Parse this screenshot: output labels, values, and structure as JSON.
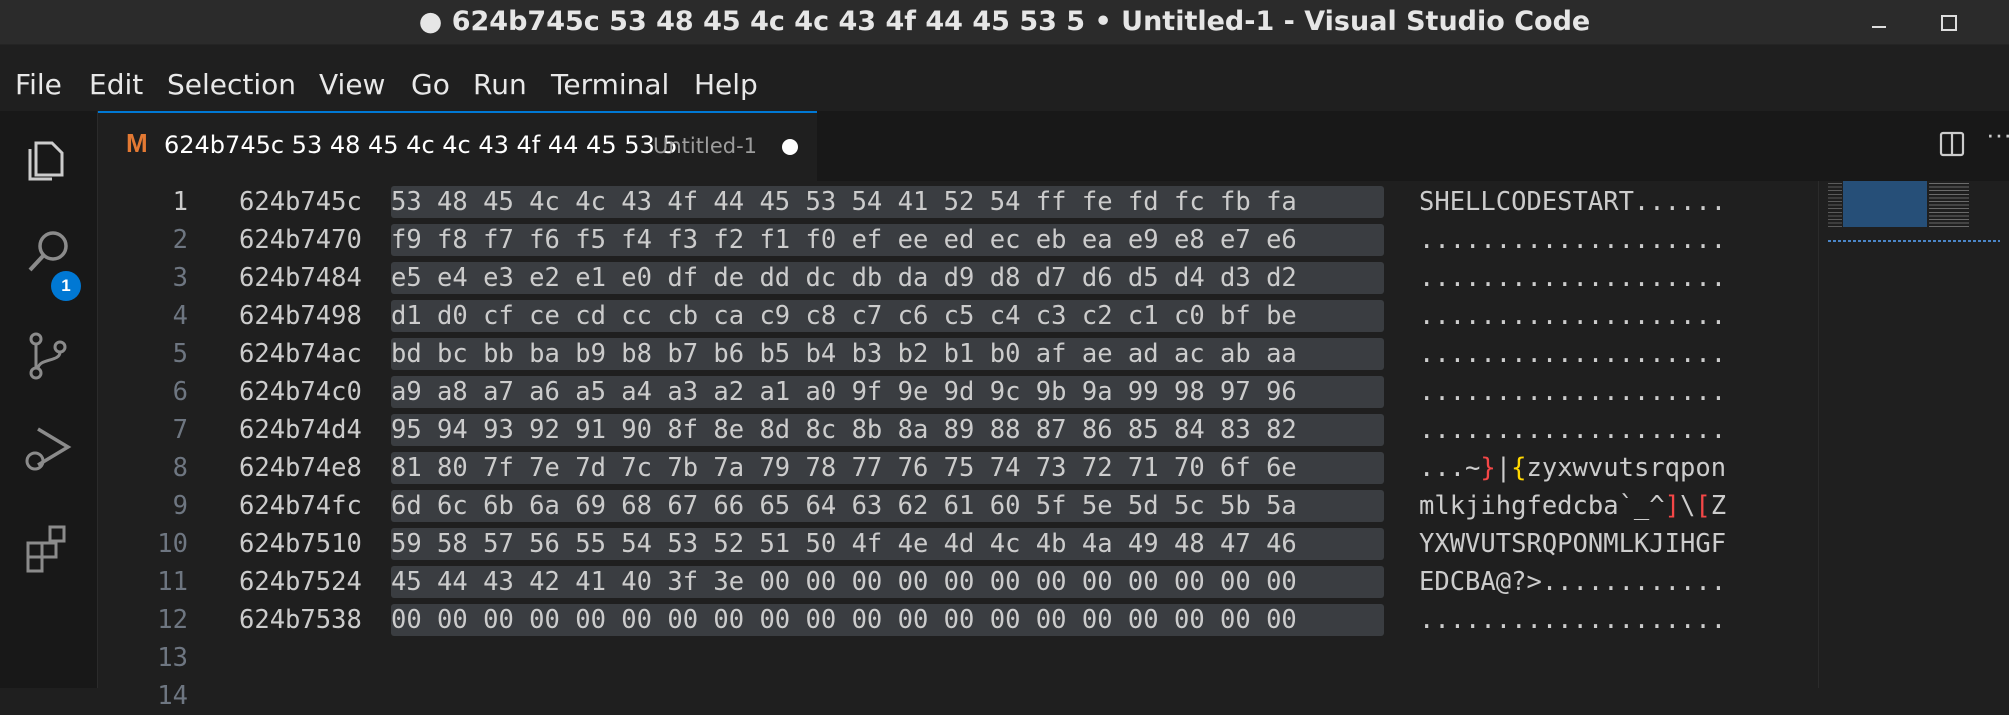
{
  "window": {
    "title": "● 624b745c 53 48 45 4c 4c 43 4f 44 45 53 5 • Untitled-1 - Visual Studio Code",
    "minimize_glyph": "",
    "maximize_glyph": ""
  },
  "menu": {
    "items": [
      "File",
      "Edit",
      "Selection",
      "View",
      "Go",
      "Run",
      "Terminal",
      "Help"
    ]
  },
  "activity": {
    "explorer_badge": "1",
    "icons": [
      "files-icon",
      "search-icon",
      "source-control-icon",
      "run-debug-icon",
      "extensions-icon"
    ]
  },
  "tab": {
    "icon_letter": "M",
    "title": "624b745c 53 48 45 4c 4c 43 4f 44 45 53 5",
    "description": "Untitled-1",
    "modified": true,
    "more_label": "···"
  },
  "editor": {
    "active_line": 1,
    "lines": [
      {
        "n": "1",
        "addr": "624b745c",
        "hex": "53 48 45 4c 4c 43 4f 44 45 53 54 41 52 54 ff fe fd fc fb fa",
        "ascii": "SHELLCODESTART......"
      },
      {
        "n": "2",
        "addr": "624b7470",
        "hex": "f9 f8 f7 f6 f5 f4 f3 f2 f1 f0 ef ee ed ec eb ea e9 e8 e7 e6",
        "ascii": "...................."
      },
      {
        "n": "3",
        "addr": "624b7484",
        "hex": "e5 e4 e3 e2 e1 e0 df de dd dc db da d9 d8 d7 d6 d5 d4 d3 d2",
        "ascii": "...................."
      },
      {
        "n": "4",
        "addr": "624b7498",
        "hex": "d1 d0 cf ce cd cc cb ca c9 c8 c7 c6 c5 c4 c3 c2 c1 c0 bf be",
        "ascii": "...................."
      },
      {
        "n": "5",
        "addr": "624b74ac",
        "hex": "bd bc bb ba b9 b8 b7 b6 b5 b4 b3 b2 b1 b0 af ae ad ac ab aa",
        "ascii": "...................."
      },
      {
        "n": "6",
        "addr": "624b74c0",
        "hex": "a9 a8 a7 a6 a5 a4 a3 a2 a1 a0 9f 9e 9d 9c 9b 9a 99 98 97 96",
        "ascii": "...................."
      },
      {
        "n": "7",
        "addr": "624b74d4",
        "hex": "95 94 93 92 91 90 8f 8e 8d 8c 8b 8a 89 88 87 86 85 84 83 82",
        "ascii": "...................."
      },
      {
        "n": "8",
        "addr": "624b74e8",
        "hex": "81 80 7f 7e 7d 7c 7b 7a 79 78 77 76 75 74 73 72 71 70 6f 6e",
        "ascii_parts": [
          {
            "t": "...~",
            "c": ""
          },
          {
            "t": "}",
            "c": "br-red"
          },
          {
            "t": "|",
            "c": ""
          },
          {
            "t": "{",
            "c": "br-yel"
          },
          {
            "t": "zyxwvutsrqpon",
            "c": ""
          }
        ]
      },
      {
        "n": "9",
        "addr": "624b74fc",
        "hex": "6d 6c 6b 6a 69 68 67 66 65 64 63 62 61 60 5f 5e 5d 5c 5b 5a",
        "ascii_parts": [
          {
            "t": "mlkjihgfedcba`_^",
            "c": ""
          },
          {
            "t": "]",
            "c": "br-red"
          },
          {
            "t": "\\",
            "c": ""
          },
          {
            "t": "[",
            "c": "br-red"
          },
          {
            "t": "Z",
            "c": ""
          }
        ]
      },
      {
        "n": "10",
        "addr": "624b7510",
        "hex": "59 58 57 56 55 54 53 52 51 50 4f 4e 4d 4c 4b 4a 49 48 47 46",
        "ascii": "YXWVUTSRQPONMLKJIHGF"
      },
      {
        "n": "11",
        "addr": "624b7524",
        "hex": "45 44 43 42 41 40 3f 3e 00 00 00 00 00 00 00 00 00 00 00 00",
        "ascii": "EDCBA@?>............"
      },
      {
        "n": "12",
        "addr": "624b7538",
        "hex": "00 00 00 00 00 00 00 00 00 00 00 00 00 00 00 00 00 00 00 00",
        "ascii": "...................."
      },
      {
        "n": "13",
        "addr": "",
        "hex": "",
        "ascii": ""
      },
      {
        "n": "14",
        "addr": "",
        "hex": "",
        "ascii": ""
      }
    ]
  },
  "colors": {
    "accent": "#0078d4",
    "tab_icon": "#e37933",
    "selection": "#3a3d41",
    "bracket_red": "#f44747",
    "bracket_yellow": "#ffd700"
  }
}
